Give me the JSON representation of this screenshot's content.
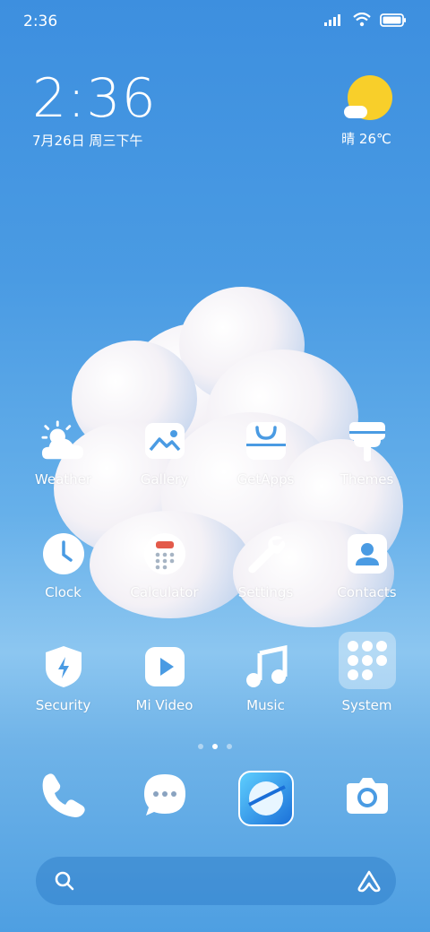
{
  "status_bar": {
    "time": "2:36"
  },
  "clock_widget": {
    "time": "2:36",
    "date": "7月26日 周三下午"
  },
  "weather_widget": {
    "condition_temp": "晴 26℃"
  },
  "apps": [
    {
      "label": "Weather",
      "icon": "weather-icon"
    },
    {
      "label": "Gallery",
      "icon": "gallery-icon"
    },
    {
      "label": "GetApps",
      "icon": "getapps-icon"
    },
    {
      "label": "Themes",
      "icon": "themes-icon"
    },
    {
      "label": "Clock",
      "icon": "clock-icon"
    },
    {
      "label": "Calculator",
      "icon": "calculator-icon"
    },
    {
      "label": "Settings",
      "icon": "settings-icon"
    },
    {
      "label": "Contacts",
      "icon": "contacts-icon"
    },
    {
      "label": "Security",
      "icon": "security-icon"
    },
    {
      "label": "Mi Video",
      "icon": "mi-video-icon"
    },
    {
      "label": "Music",
      "icon": "music-icon"
    },
    {
      "label": "System",
      "icon": "system-folder-icon"
    }
  ],
  "page_indicator": {
    "count": 3,
    "active": 1
  },
  "dock": [
    "phone-icon",
    "messages-icon",
    "browser-icon",
    "camera-icon"
  ]
}
